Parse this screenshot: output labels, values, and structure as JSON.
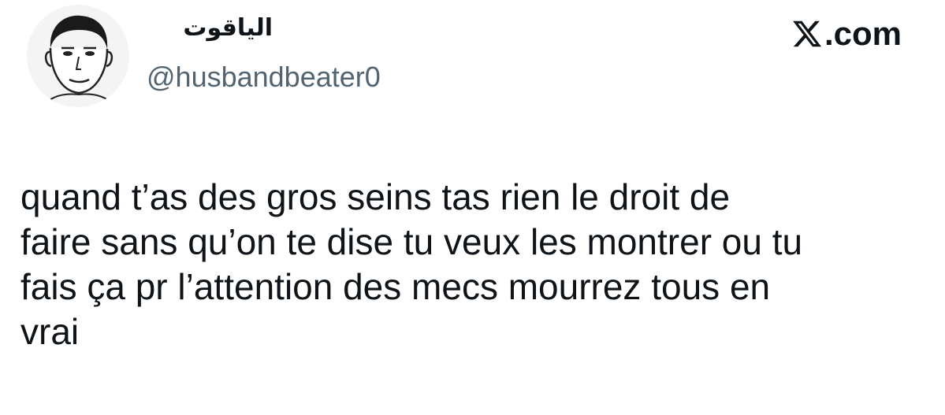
{
  "author": {
    "display_name": "الياقوت",
    "handle": "@husbandbeater0",
    "avatar_icon": "profile-avatar-drawing"
  },
  "brand": {
    "label": ".com",
    "icon": "x-logo-icon"
  },
  "tweet": {
    "text": "quand t’as des gros seins tas rien le droit de\nfaire sans qu’on te dise tu veux les montrer ou tu\nfais ça pr l’attention des mecs mourrez tous en\nvrai"
  },
  "colors": {
    "text_primary": "#0f1419",
    "text_secondary": "#536471",
    "background": "#ffffff"
  }
}
